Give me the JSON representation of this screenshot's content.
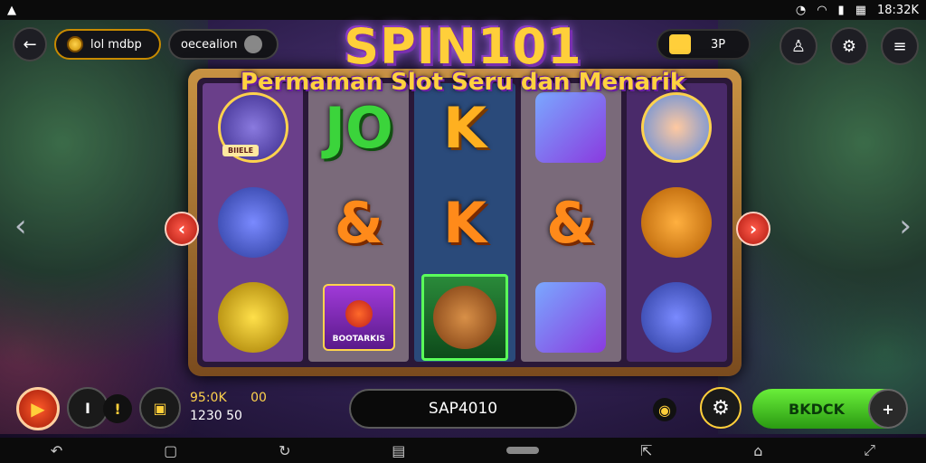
{
  "status_bar": {
    "left_icon": "warning-triangle-icon",
    "time": "18:32K"
  },
  "top_bar": {
    "balance_label": "lol mdbp",
    "mode_label": "oecealion",
    "right_counter": "3P"
  },
  "game": {
    "title": "SPIN101",
    "subtitle": "Permaman Slot Seru dan Menarik",
    "reels": [
      [
        {
          "type": "cat",
          "ribbon": "BIIELE"
        },
        {
          "type": "dog"
        },
        {
          "type": "lemon"
        }
      ],
      [
        {
          "type": "letter",
          "text": "JO",
          "color": "green"
        },
        {
          "type": "letter",
          "text": "&",
          "color": "orange"
        },
        {
          "type": "card",
          "text": "BOOTARKIS"
        }
      ],
      [
        {
          "type": "letter",
          "text": "K",
          "color": "gold"
        },
        {
          "type": "letter",
          "text": "K",
          "color": "orange"
        },
        {
          "type": "bear"
        }
      ],
      [
        {
          "type": "cube"
        },
        {
          "type": "letter",
          "text": "&",
          "color": "orange"
        },
        {
          "type": "cube"
        }
      ],
      [
        {
          "type": "girl"
        },
        {
          "type": "fox"
        },
        {
          "type": "dog"
        }
      ]
    ]
  },
  "bottom_bar": {
    "bet_line1": "95:0K",
    "bet_line1_extra": "00",
    "bet_line2": "1230 50",
    "spin_code": "SAP4010",
    "back_label": "BKDCK"
  },
  "colors": {
    "accent_gold": "#ffcf3a",
    "play_red": "#e0301a",
    "back_green": "#3ac41a"
  }
}
